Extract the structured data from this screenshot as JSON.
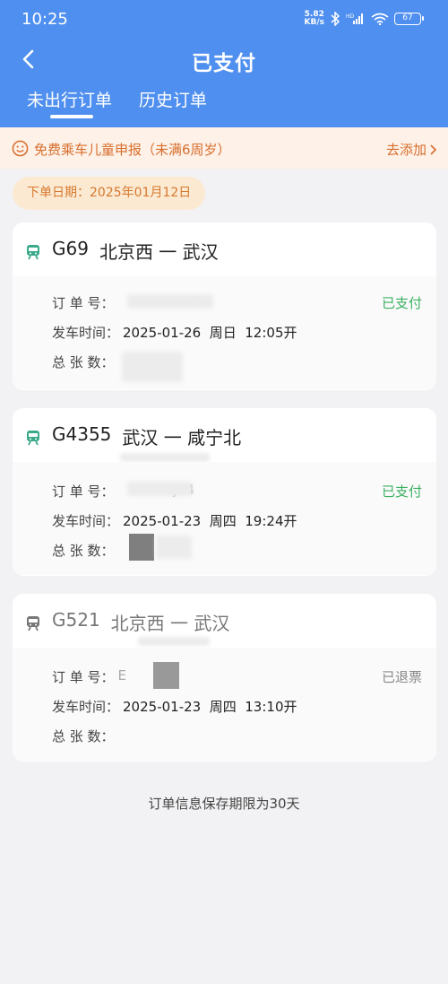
{
  "status_bar": {
    "time": "10:25",
    "net_speed": "5.82",
    "net_unit": "KB/s",
    "battery": "67"
  },
  "header": {
    "title": "已支付",
    "tabs": [
      {
        "label": "未出行订单"
      },
      {
        "label": "历史订单"
      }
    ]
  },
  "notice": {
    "text": "免费乘车儿童申报（未满6周岁）",
    "link": "去添加"
  },
  "date_pill": "下单日期：2025年01月12日",
  "labels": {
    "order_no": "订 单 号：",
    "depart_time": "发车时间：",
    "total": "总 张 数："
  },
  "orders": [
    {
      "train": "G69",
      "route": "北京西 一 武汉",
      "order_no_visible": "3",
      "depart_time": "2025-01-26  周日  12:05开",
      "total": "",
      "status": "已支付",
      "status_color": "#3bb061",
      "icon_color": "#3aa98a"
    },
    {
      "train": "G4355",
      "route": "武汉 一 咸宁北",
      "order_no_visible": "J04",
      "depart_time": "2025-01-23  周四  19:24开",
      "total": "",
      "status": "已支付",
      "status_color": "#3bb061",
      "icon_color": "#3aa98a"
    },
    {
      "train": "G521",
      "route": "北京西 一 武汉",
      "order_no_visible": "E",
      "depart_time": "2025-01-23  周四  13:10开",
      "total": "",
      "status": "已退票",
      "status_color": "#888888",
      "icon_color": "#777777"
    }
  ],
  "footer": "订单信息保存期限为30天"
}
